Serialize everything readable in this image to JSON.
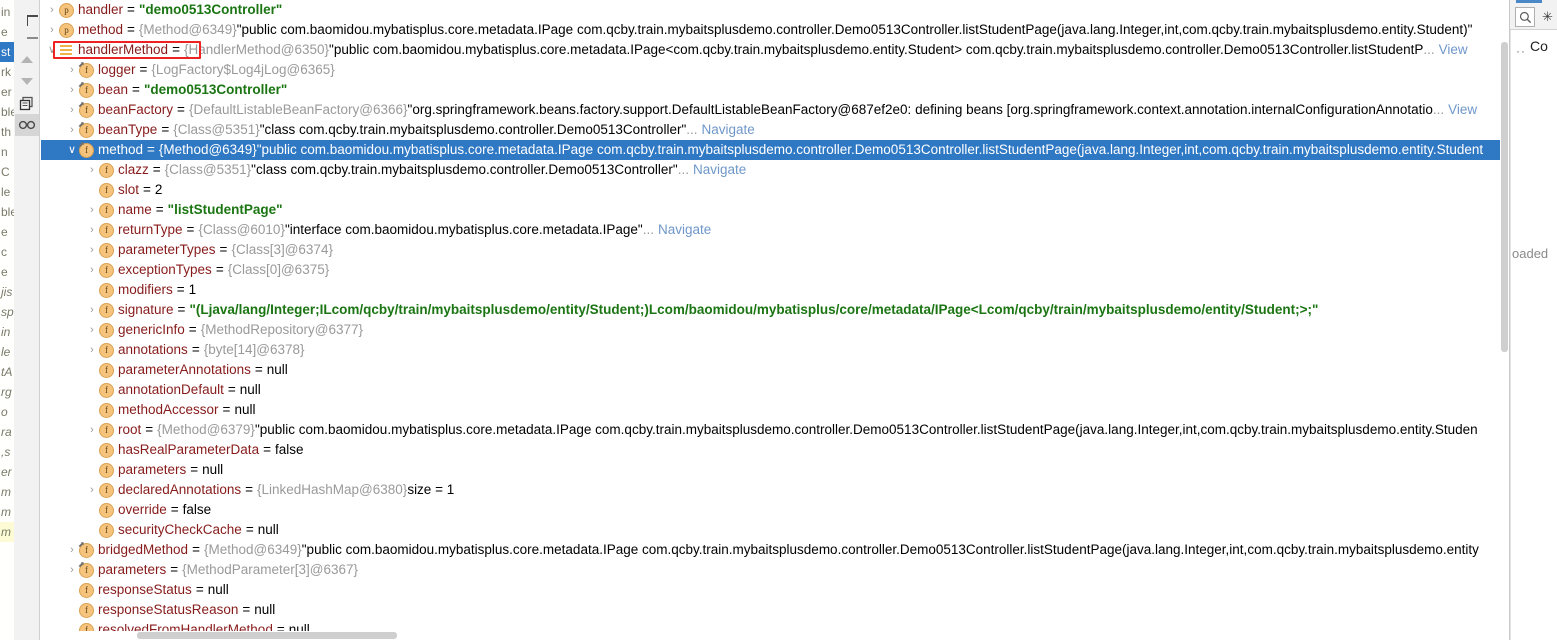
{
  "window": {
    "kind": "intellij-debugger-variables-popup"
  },
  "editor_peek": {
    "lines": [
      "in",
      "e",
      "st",
      "rk",
      "er",
      "ble",
      "th",
      "n",
      "C",
      "le",
      "ble",
      "e",
      "c",
      "e",
      "jis",
      "sp",
      "in",
      "le",
      "tA",
      "rg",
      "o",
      "ra",
      ",s",
      "er",
      "m",
      "m"
    ]
  },
  "left_toolbar": {
    "items": [
      {
        "name": "add-watch-button",
        "icon": "plus-icon",
        "label": "+"
      },
      {
        "name": "remove-watch-button",
        "icon": "minus-icon",
        "label": "−"
      },
      {
        "name": "move-up-button",
        "icon": "arrow-up-icon",
        "label": "▲"
      },
      {
        "name": "move-down-button",
        "icon": "arrow-down-icon",
        "label": "▼"
      },
      {
        "name": "copy-value-button",
        "icon": "copy-icon",
        "label": "❐"
      },
      {
        "name": "watches-toggle-button",
        "icon": "glasses-icon",
        "label": "∞"
      }
    ]
  },
  "right_strip": {
    "search_icon": "search-icon",
    "asterisk": "✳",
    "dots": "··",
    "label": "Co",
    "loaded_text": "oaded"
  },
  "annotation": {
    "redbox_label": "handlerMethod-highlight",
    "color": "#ee2222"
  },
  "colors": {
    "selection": "#2f78c4",
    "name": "#871b1b",
    "reference": "#9a9a9a",
    "string": "#1a7512",
    "link": "#6f97c9",
    "icon_badge": "#f5c37b"
  },
  "tree": {
    "rows": [
      {
        "indent": 1,
        "chevron": "›",
        "icon": "p",
        "icon_kind": "badge",
        "name": "handler",
        "eq": "=",
        "segments": [
          {
            "t": "\"demo0513Controller\"",
            "c": "strv"
          }
        ],
        "selected": false
      },
      {
        "indent": 1,
        "chevron": "›",
        "icon": "p",
        "icon_kind": "badge",
        "name": "method",
        "eq": "=",
        "segments": [
          {
            "t": "{Method@6349}",
            "c": "ref"
          },
          {
            "t": " \"public com.baomidou.mybatisplus.core.metadata.IPage com.qcby.train.mybaitsplusdemo.controller.Demo0513Controller.listStudentPage(java.lang.Integer,int,com.qcby.train.mybaitsplusdemo.entity.Student)\"",
            "c": "val"
          }
        ],
        "selected": false
      },
      {
        "indent": 1,
        "chevron": "∨",
        "icon": "list",
        "icon_kind": "list",
        "name": "handlerMethod",
        "eq": "=",
        "segments": [
          {
            "t": "{HandlerMethod@6350}",
            "c": "ref"
          },
          {
            "t": " \"public com.baomidou.mybatisplus.core.metadata.IPage<com.qcby.train.mybaitsplusdemo.entity.Student> com.qcby.train.mybaitsplusdemo.controller.Demo0513Controller.listStudentP",
            "c": "val"
          },
          {
            "t": "...",
            "c": "ref"
          },
          {
            "t": "View",
            "c": "lnk"
          }
        ],
        "selected": false,
        "highlight": true
      },
      {
        "indent": 2,
        "chevron": "›",
        "icon": "f",
        "icon_kind": "badge",
        "inherited": true,
        "name": "logger",
        "eq": "=",
        "segments": [
          {
            "t": "{LogFactory$Log4jLog@6365}",
            "c": "ref"
          }
        ],
        "selected": false
      },
      {
        "indent": 2,
        "chevron": "›",
        "icon": "f",
        "icon_kind": "badge",
        "inherited": true,
        "name": "bean",
        "eq": "=",
        "segments": [
          {
            "t": "\"demo0513Controller\"",
            "c": "strv"
          }
        ],
        "selected": false
      },
      {
        "indent": 2,
        "chevron": "›",
        "icon": "f",
        "icon_kind": "badge",
        "inherited": true,
        "name": "beanFactory",
        "eq": "=",
        "segments": [
          {
            "t": "{DefaultListableBeanFactory@6366}",
            "c": "ref"
          },
          {
            "t": " \"org.springframework.beans.factory.support.DefaultListableBeanFactory@687ef2e0: defining beans [org.springframework.context.annotation.internalConfigurationAnnotatio",
            "c": "val"
          },
          {
            "t": "...",
            "c": "ref"
          },
          {
            "t": "View",
            "c": "lnk"
          }
        ],
        "selected": false
      },
      {
        "indent": 2,
        "chevron": "›",
        "icon": "f",
        "icon_kind": "badge",
        "inherited": true,
        "name": "beanType",
        "eq": "=",
        "segments": [
          {
            "t": "{Class@5351}",
            "c": "ref"
          },
          {
            "t": " \"class com.qcby.train.mybaitsplusdemo.controller.Demo0513Controller\"",
            "c": "val"
          },
          {
            "t": "...",
            "c": "ref"
          },
          {
            "t": "Navigate",
            "c": "lnk"
          }
        ],
        "selected": false
      },
      {
        "indent": 2,
        "chevron": "∨",
        "icon": "f",
        "icon_kind": "badge",
        "inherited": true,
        "name": "method",
        "eq": "=",
        "segments": [
          {
            "t": "{Method@6349}",
            "c": "ref"
          },
          {
            "t": " \"public com.baomidou.mybatisplus.core.metadata.IPage com.qcby.train.mybaitsplusdemo.controller.Demo0513Controller.listStudentPage(java.lang.Integer,int,com.qcby.train.mybaitsplusdemo.entity.Student",
            "c": "val"
          }
        ],
        "selected": true
      },
      {
        "indent": 3,
        "chevron": "›",
        "icon": "f",
        "icon_kind": "badge",
        "name": "clazz",
        "eq": "=",
        "segments": [
          {
            "t": "{Class@5351}",
            "c": "ref"
          },
          {
            "t": " \"class com.qcby.train.mybaitsplusdemo.controller.Demo0513Controller\"",
            "c": "val"
          },
          {
            "t": "...",
            "c": "ref"
          },
          {
            "t": "Navigate",
            "c": "lnk"
          }
        ],
        "selected": false
      },
      {
        "indent": 3,
        "chevron": "",
        "icon": "f",
        "icon_kind": "badge",
        "name": "slot",
        "eq": "=",
        "segments": [
          {
            "t": "2",
            "c": "val"
          }
        ],
        "selected": false
      },
      {
        "indent": 3,
        "chevron": "›",
        "icon": "f",
        "icon_kind": "badge",
        "name": "name",
        "eq": "=",
        "segments": [
          {
            "t": "\"listStudentPage\"",
            "c": "strv"
          }
        ],
        "selected": false
      },
      {
        "indent": 3,
        "chevron": "›",
        "icon": "f",
        "icon_kind": "badge",
        "name": "returnType",
        "eq": "=",
        "segments": [
          {
            "t": "{Class@6010}",
            "c": "ref"
          },
          {
            "t": " \"interface com.baomidou.mybatisplus.core.metadata.IPage\"",
            "c": "val"
          },
          {
            "t": "...",
            "c": "ref"
          },
          {
            "t": "Navigate",
            "c": "lnk"
          }
        ],
        "selected": false
      },
      {
        "indent": 3,
        "chevron": "›",
        "icon": "f",
        "icon_kind": "badge",
        "name": "parameterTypes",
        "eq": "=",
        "segments": [
          {
            "t": "{Class[3]@6374}",
            "c": "ref"
          }
        ],
        "selected": false
      },
      {
        "indent": 3,
        "chevron": "›",
        "icon": "f",
        "icon_kind": "badge",
        "name": "exceptionTypes",
        "eq": "=",
        "segments": [
          {
            "t": "{Class[0]@6375}",
            "c": "ref"
          }
        ],
        "selected": false
      },
      {
        "indent": 3,
        "chevron": "",
        "icon": "f",
        "icon_kind": "badge",
        "name": "modifiers",
        "eq": "=",
        "segments": [
          {
            "t": "1",
            "c": "val"
          }
        ],
        "selected": false
      },
      {
        "indent": 3,
        "chevron": "›",
        "icon": "f",
        "icon_kind": "badge",
        "name": "signature",
        "eq": "=",
        "segments": [
          {
            "t": "\"(Ljava/lang/Integer;ILcom/qcby/train/mybaitsplusdemo/entity/Student;)Lcom/baomidou/mybatisplus/core/metadata/IPage<Lcom/qcby/train/mybaitsplusdemo/entity/Student;>;\"",
            "c": "strv"
          }
        ],
        "selected": false
      },
      {
        "indent": 3,
        "chevron": "›",
        "icon": "f",
        "icon_kind": "badge",
        "name": "genericInfo",
        "eq": "=",
        "segments": [
          {
            "t": "{MethodRepository@6377}",
            "c": "ref"
          }
        ],
        "selected": false
      },
      {
        "indent": 3,
        "chevron": "›",
        "icon": "f",
        "icon_kind": "badge",
        "name": "annotations",
        "eq": "=",
        "segments": [
          {
            "t": "{byte[14]@6378}",
            "c": "ref"
          }
        ],
        "selected": false
      },
      {
        "indent": 3,
        "chevron": "",
        "icon": "f",
        "icon_kind": "badge",
        "name": "parameterAnnotations",
        "eq": "=",
        "segments": [
          {
            "t": "null",
            "c": "val"
          }
        ],
        "selected": false
      },
      {
        "indent": 3,
        "chevron": "",
        "icon": "f",
        "icon_kind": "badge",
        "name": "annotationDefault",
        "eq": "=",
        "segments": [
          {
            "t": "null",
            "c": "val"
          }
        ],
        "selected": false
      },
      {
        "indent": 3,
        "chevron": "",
        "icon": "f",
        "icon_kind": "badge",
        "name": "methodAccessor",
        "eq": "=",
        "segments": [
          {
            "t": "null",
            "c": "val"
          }
        ],
        "selected": false
      },
      {
        "indent": 3,
        "chevron": "›",
        "icon": "f",
        "icon_kind": "badge",
        "name": "root",
        "eq": "=",
        "segments": [
          {
            "t": "{Method@6379}",
            "c": "ref"
          },
          {
            "t": " \"public com.baomidou.mybatisplus.core.metadata.IPage com.qcby.train.mybaitsplusdemo.controller.Demo0513Controller.listStudentPage(java.lang.Integer,int,com.qcby.train.mybaitsplusdemo.entity.Studen",
            "c": "val"
          }
        ],
        "selected": false
      },
      {
        "indent": 3,
        "chevron": "",
        "icon": "f",
        "icon_kind": "badge",
        "name": "hasRealParameterData",
        "eq": "=",
        "segments": [
          {
            "t": "false",
            "c": "val"
          }
        ],
        "selected": false
      },
      {
        "indent": 3,
        "chevron": "",
        "icon": "f",
        "icon_kind": "badge",
        "name": "parameters",
        "eq": "=",
        "segments": [
          {
            "t": "null",
            "c": "val"
          }
        ],
        "selected": false
      },
      {
        "indent": 3,
        "chevron": "›",
        "icon": "f",
        "icon_kind": "badge",
        "name": "declaredAnnotations",
        "eq": "=",
        "segments": [
          {
            "t": "{LinkedHashMap@6380}",
            "c": "ref"
          },
          {
            "t": "  size = 1",
            "c": "val"
          }
        ],
        "selected": false
      },
      {
        "indent": 3,
        "chevron": "",
        "icon": "f",
        "icon_kind": "badge",
        "name": "override",
        "eq": "=",
        "segments": [
          {
            "t": "false",
            "c": "val"
          }
        ],
        "selected": false
      },
      {
        "indent": 3,
        "chevron": "",
        "icon": "f",
        "icon_kind": "badge",
        "name": "securityCheckCache",
        "eq": "=",
        "segments": [
          {
            "t": "null",
            "c": "val"
          }
        ],
        "selected": false
      },
      {
        "indent": 2,
        "chevron": "›",
        "icon": "f",
        "icon_kind": "badge",
        "inherited": true,
        "name": "bridgedMethod",
        "eq": "=",
        "segments": [
          {
            "t": "{Method@6349}",
            "c": "ref"
          },
          {
            "t": " \"public com.baomidou.mybatisplus.core.metadata.IPage com.qcby.train.mybaitsplusdemo.controller.Demo0513Controller.listStudentPage(java.lang.Integer,int,com.qcby.train.mybaitsplusdemo.entity",
            "c": "val"
          }
        ],
        "selected": false
      },
      {
        "indent": 2,
        "chevron": "›",
        "icon": "f",
        "icon_kind": "badge",
        "inherited": true,
        "name": "parameters",
        "eq": "=",
        "segments": [
          {
            "t": "{MethodParameter[3]@6367}",
            "c": "ref"
          }
        ],
        "selected": false
      },
      {
        "indent": 2,
        "chevron": "",
        "icon": "f",
        "icon_kind": "badge",
        "name": "responseStatus",
        "eq": "=",
        "segments": [
          {
            "t": "null",
            "c": "val"
          }
        ],
        "selected": false
      },
      {
        "indent": 2,
        "chevron": "",
        "icon": "f",
        "icon_kind": "badge",
        "name": "responseStatusReason",
        "eq": "=",
        "segments": [
          {
            "t": "null",
            "c": "val"
          }
        ],
        "selected": false
      },
      {
        "indent": 2,
        "chevron": "",
        "icon": "f",
        "icon_kind": "badge",
        "name": "resolvedFromHandlerMethod",
        "eq": "=",
        "segments": [
          {
            "t": "null",
            "c": "val"
          }
        ],
        "selected": false
      }
    ]
  }
}
